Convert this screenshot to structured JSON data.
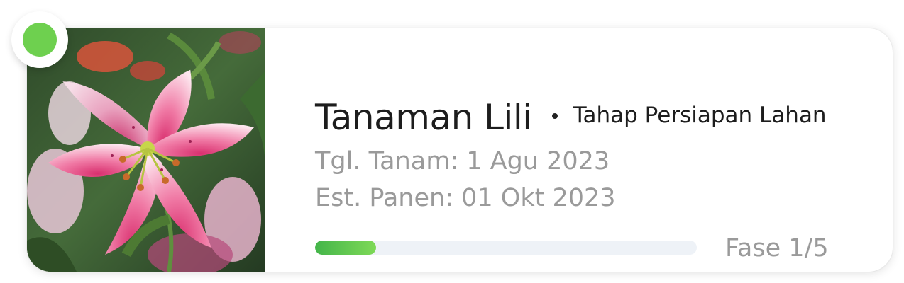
{
  "plant": {
    "name": "Tanaman Lili",
    "stage": "Tahap Persiapan Lahan",
    "planted": "Tgl. Tanam: 1 Agu 2023",
    "harvest": "Est. Panen: 01 Okt 2023",
    "phase_label": "Fase 1/5",
    "progress_fraction": 0.16,
    "status_color": "#6ed04f",
    "progress_colors": [
      "#44b54a",
      "#7ed957"
    ],
    "image": "lily-flower-photo"
  }
}
